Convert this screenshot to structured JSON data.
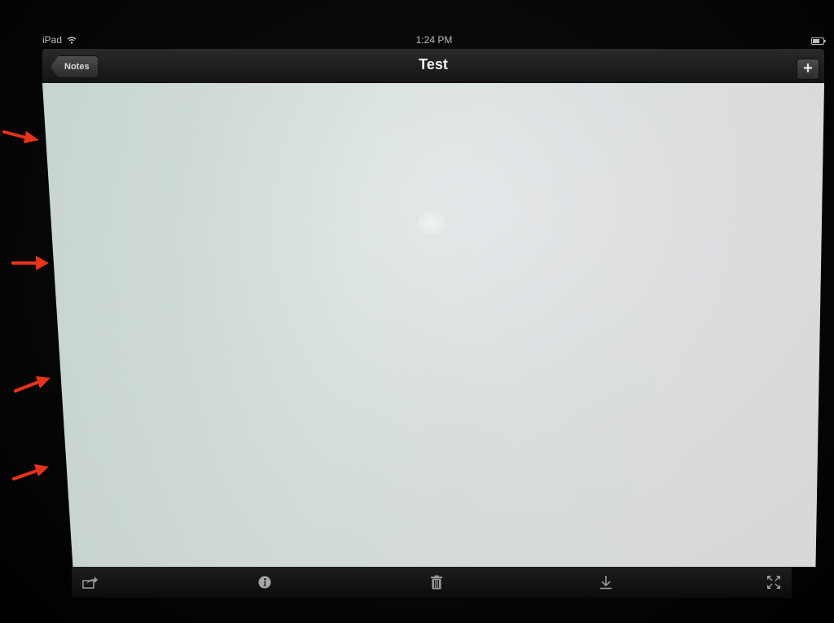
{
  "status_bar": {
    "device": "iPad",
    "time": "1:24 PM",
    "icons": [
      "wifi-icon",
      "battery-icon"
    ]
  },
  "nav_bar": {
    "back_label": "Notes",
    "title": "Test",
    "add_label": "+"
  },
  "note": {
    "content": ""
  },
  "toolbar": {
    "icons": [
      "share-icon",
      "info-icon",
      "trash-icon",
      "download-icon",
      "fullscreen-icon"
    ]
  },
  "annotations": {
    "arrow_count": 4,
    "arrow_color": "#e8321c"
  },
  "colors": {
    "bar_dark": "#141414",
    "page": "#d6dfdd",
    "text_light": "#f2f2f2"
  }
}
